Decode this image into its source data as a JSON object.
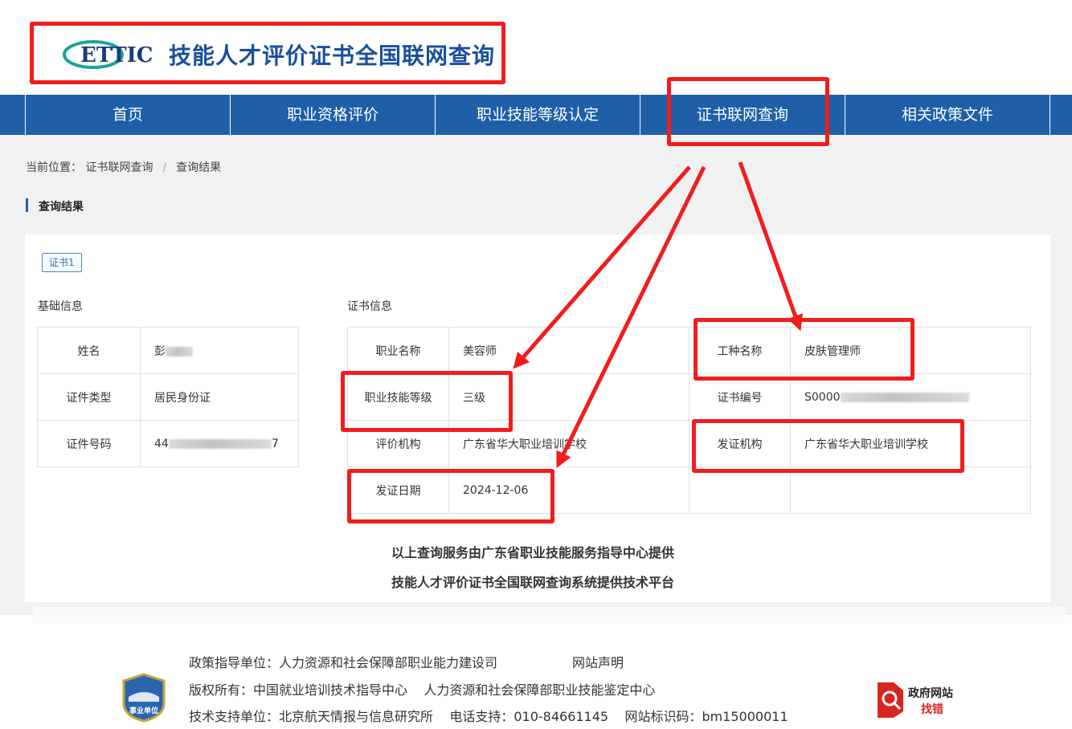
{
  "header": {
    "logo_mark_text": "ETTIC",
    "site_title": "技能人才评价证书全国联网查询"
  },
  "nav": {
    "items": [
      {
        "label": "首页"
      },
      {
        "label": "职业资格评价"
      },
      {
        "label": "职业技能等级认定"
      },
      {
        "label": "证书联网查询"
      },
      {
        "label": "相关政策文件"
      }
    ]
  },
  "breadcrumb": {
    "prefix": "当前位置：",
    "items": [
      "证书联网查询",
      "查询结果"
    ],
    "separator": "/"
  },
  "section": {
    "title": "查询结果"
  },
  "cert_tab": {
    "label": "证书1"
  },
  "basic_info": {
    "title": "基础信息",
    "name_label": "姓名",
    "name_value": "彭",
    "id_type_label": "证件类型",
    "id_type_value": "居民身份证",
    "id_number_label": "证件号码",
    "id_number_start": "44",
    "id_number_end": "7"
  },
  "cert_info": {
    "title": "证书信息",
    "occupation_label": "职业名称",
    "occupation_value": "美容师",
    "job_type_label": "工种名称",
    "job_type_value": "皮肤管理师",
    "level_label": "职业技能等级",
    "level_value": "三级",
    "cert_no_label": "证书编号",
    "cert_no_value": "S0000",
    "eval_org_label": "评价机构",
    "eval_org_value": "广东省华大职业培训学校",
    "issuer_label": "发证机构",
    "issuer_value": "广东省华大职业培训学校",
    "issue_date_label": "发证日期",
    "issue_date_value": "2024-12-06"
  },
  "notes": {
    "line1": "以上查询服务由广东省职业技能服务指导中心提供",
    "line2": "技能人才评价证书全国联网查询系统提供技术平台"
  },
  "footer": {
    "policy": "政策指导单位：人力资源和社会保障部职业能力建设司",
    "statement": "网站声明",
    "copyright": "版权所有：中国就业培训技术指导中心    人力资源和社会保障部职业技能鉴定中心",
    "support": "技术支持单位：北京航天情报与信息研究所    电话支持：010-84661145    网站标识码：bm15000011",
    "badge_text": "事业单位",
    "gov_link_line1": "政府网站",
    "gov_link_line2": "找错"
  },
  "colors": {
    "nav_blue": "#1e5fa8",
    "annotation_red": "#f21c1c",
    "title_blue": "#1a4f9c"
  }
}
